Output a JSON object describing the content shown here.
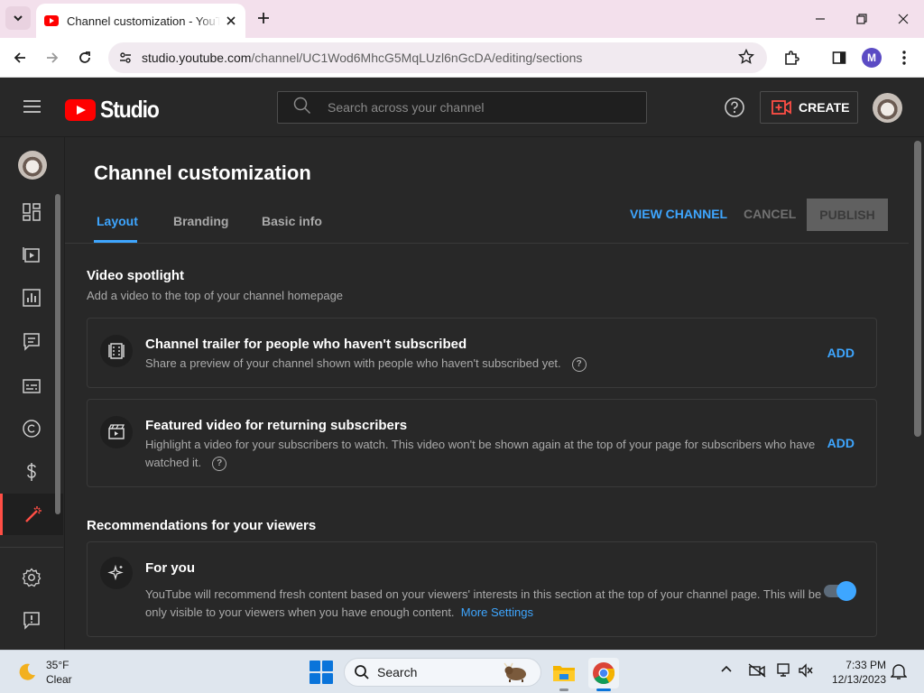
{
  "browser": {
    "tab_title": "Channel customization - YouTube Studio",
    "url_host": "studio.youtube.com",
    "url_path": "/channel/UC1Wod6MhcG5MqLUzl6nGcDA/editing/sections",
    "profile_initial": "M"
  },
  "studio": {
    "logo_text": "Studio",
    "search_placeholder": "Search across your channel",
    "create_label": "CREATE",
    "sidebar_items": [
      "dashboard-icon",
      "content-icon",
      "analytics-icon",
      "comments-icon",
      "subtitles-icon",
      "copyright-icon",
      "earn-icon",
      "customization-icon",
      "settings-icon",
      "feedback-icon"
    ]
  },
  "page": {
    "title": "Channel customization",
    "tabs": [
      {
        "label": "Layout",
        "active": true
      },
      {
        "label": "Branding",
        "active": false
      },
      {
        "label": "Basic info",
        "active": false
      }
    ],
    "view_channel": "VIEW CHANNEL",
    "cancel": "CANCEL",
    "publish": "PUBLISH"
  },
  "spotlight": {
    "title": "Video spotlight",
    "subtitle": "Add a video to the top of your channel homepage",
    "trailer": {
      "title": "Channel trailer for people who haven't subscribed",
      "desc": "Share a preview of your channel shown with people who haven't subscribed yet.",
      "action": "ADD"
    },
    "featured": {
      "title": "Featured video for returning subscribers",
      "desc": "Highlight a video for your subscribers to watch. This video won't be shown again at the top of your page for subscribers who have watched it.",
      "action": "ADD"
    }
  },
  "recommendations": {
    "title": "Recommendations for your viewers",
    "for_you": {
      "title": "For you",
      "desc": "YouTube will recommend fresh content based on your viewers' interests in this section at the top of your channel page. This will be only visible to your viewers when you have enough content.",
      "link": "More Settings",
      "enabled": true
    }
  },
  "taskbar": {
    "temperature": "35°F",
    "condition": "Clear",
    "search_label": "Search",
    "time": "7:33 PM",
    "date": "12/13/2023"
  },
  "colors": {
    "accent": "#3ea6ff",
    "brand": "#ff0000",
    "active_indicator": "#ff4e45"
  }
}
